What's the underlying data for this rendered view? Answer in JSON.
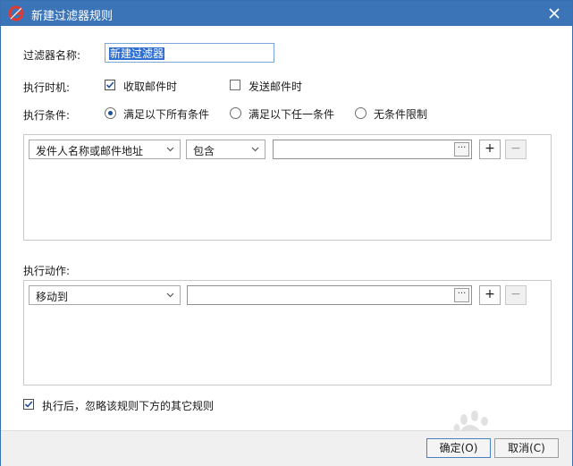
{
  "window": {
    "title": "新建过滤器规则"
  },
  "form": {
    "name_label": "过滤器名称:",
    "name_value": "新建过滤器",
    "timing_label": "执行时机:",
    "timing_options": [
      {
        "label": "收取邮件时",
        "checked": true
      },
      {
        "label": "发送邮件时",
        "checked": false
      }
    ],
    "condition_label": "执行条件:",
    "condition_options": [
      {
        "label": "满足以下所有条件",
        "selected": true
      },
      {
        "label": "满足以下任一条件",
        "selected": false
      },
      {
        "label": "无条件限制",
        "selected": false
      }
    ]
  },
  "conditions": {
    "field_value": "发件人名称或邮件地址",
    "operator_value": "包含",
    "text_value": "",
    "ellipsis_label": "···",
    "add_label": "+",
    "remove_label": "−"
  },
  "actions": {
    "label": "执行动作:",
    "action_value": "移动到",
    "text_value": "",
    "ellipsis_label": "···",
    "add_label": "+",
    "remove_label": "−"
  },
  "ignore_rules": {
    "label": "执行后，忽略该规则下方的其它规则",
    "checked": true
  },
  "buttons": {
    "ok_label": "确定(O)",
    "cancel_label": "取消(C)"
  },
  "colors": {
    "titlebar": "#3c74b8",
    "accent": "#2f6fd1",
    "logo_red": "#e23b2e"
  }
}
